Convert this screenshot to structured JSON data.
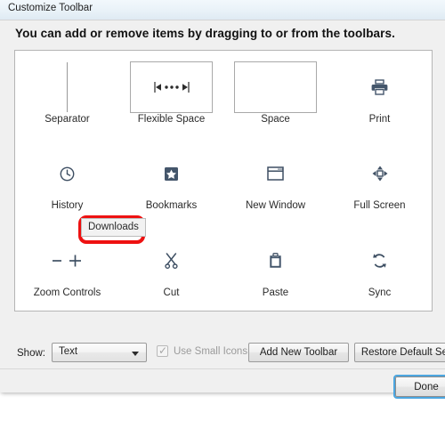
{
  "window": {
    "title": "Customize Toolbar",
    "headline": "You can add or remove items by dragging to or from the toolbars."
  },
  "items": [
    {
      "label": "Separator",
      "icon": "separator-icon"
    },
    {
      "label": "Flexible Space",
      "icon": "flexible-space-icon"
    },
    {
      "label": "Space",
      "icon": "space-icon"
    },
    {
      "label": "Print",
      "icon": "printer-icon"
    },
    {
      "label": "History",
      "icon": "clock-icon"
    },
    {
      "label": "Bookmarks",
      "icon": "star-icon"
    },
    {
      "label": "New Window",
      "icon": "window-icon"
    },
    {
      "label": "Full Screen",
      "icon": "full-screen-icon"
    },
    {
      "label": "Zoom Controls",
      "icon": "zoom-minus-plus-icon"
    },
    {
      "label": "Cut",
      "icon": "scissors-icon"
    },
    {
      "label": "Paste",
      "icon": "clipboard-icon"
    },
    {
      "label": "Sync",
      "icon": "sync-icon"
    }
  ],
  "drag": {
    "ghost_label": "Downloads",
    "highlight_color": "#ee1111"
  },
  "controls": {
    "show_label": "Show:",
    "show_value": "Text",
    "small_icons_label": "Use Small Icons",
    "small_icons_checked": "✓",
    "add_toolbar_label": "Add New Toolbar",
    "restore_label": "Restore Default Set",
    "done_label": "Done"
  }
}
